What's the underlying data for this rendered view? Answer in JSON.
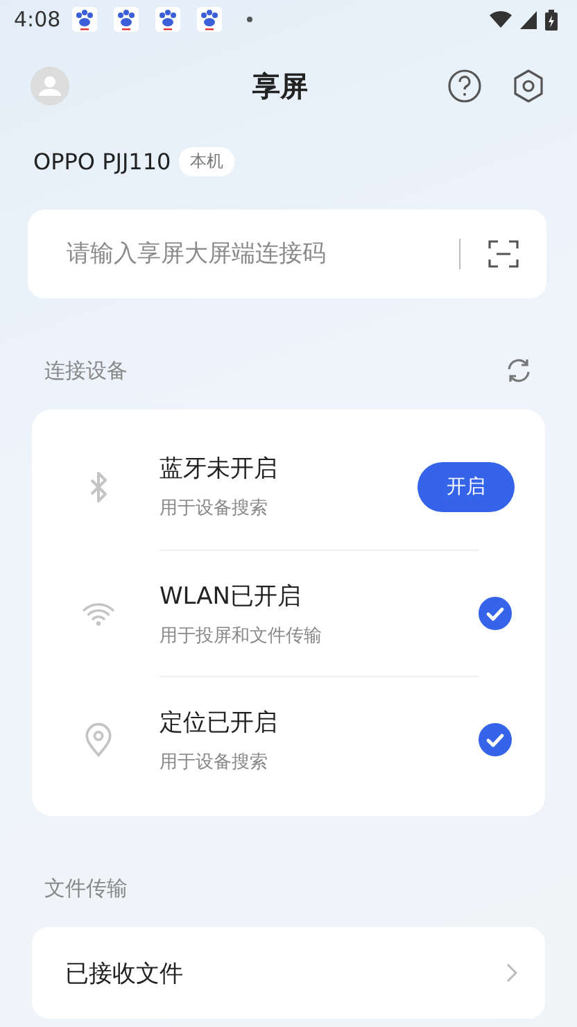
{
  "status_bar": {
    "time": "4:08",
    "notifications": [
      {
        "kind": "app"
      },
      {
        "kind": "app"
      },
      {
        "kind": "app"
      },
      {
        "kind": "app"
      }
    ]
  },
  "header": {
    "title": "享屏"
  },
  "device": {
    "name": "OPPO PJJ110",
    "badge": "本机"
  },
  "connect_field": {
    "placeholder": "请输入享屏大屏端连接码"
  },
  "connect_section": {
    "title": "连接设备",
    "items": [
      {
        "kind": "bluetooth",
        "title": "蓝牙未开启",
        "subtitle": "用于设备搜索",
        "enabled": false,
        "action": "开启"
      },
      {
        "kind": "wlan",
        "title": "WLAN已开启",
        "subtitle": "用于投屏和文件传输",
        "enabled": true
      },
      {
        "kind": "location",
        "title": "定位已开启",
        "subtitle": "用于设备搜索",
        "enabled": true
      }
    ]
  },
  "file_section": {
    "title": "文件传输",
    "items": [
      {
        "label": "已接收文件"
      }
    ]
  }
}
